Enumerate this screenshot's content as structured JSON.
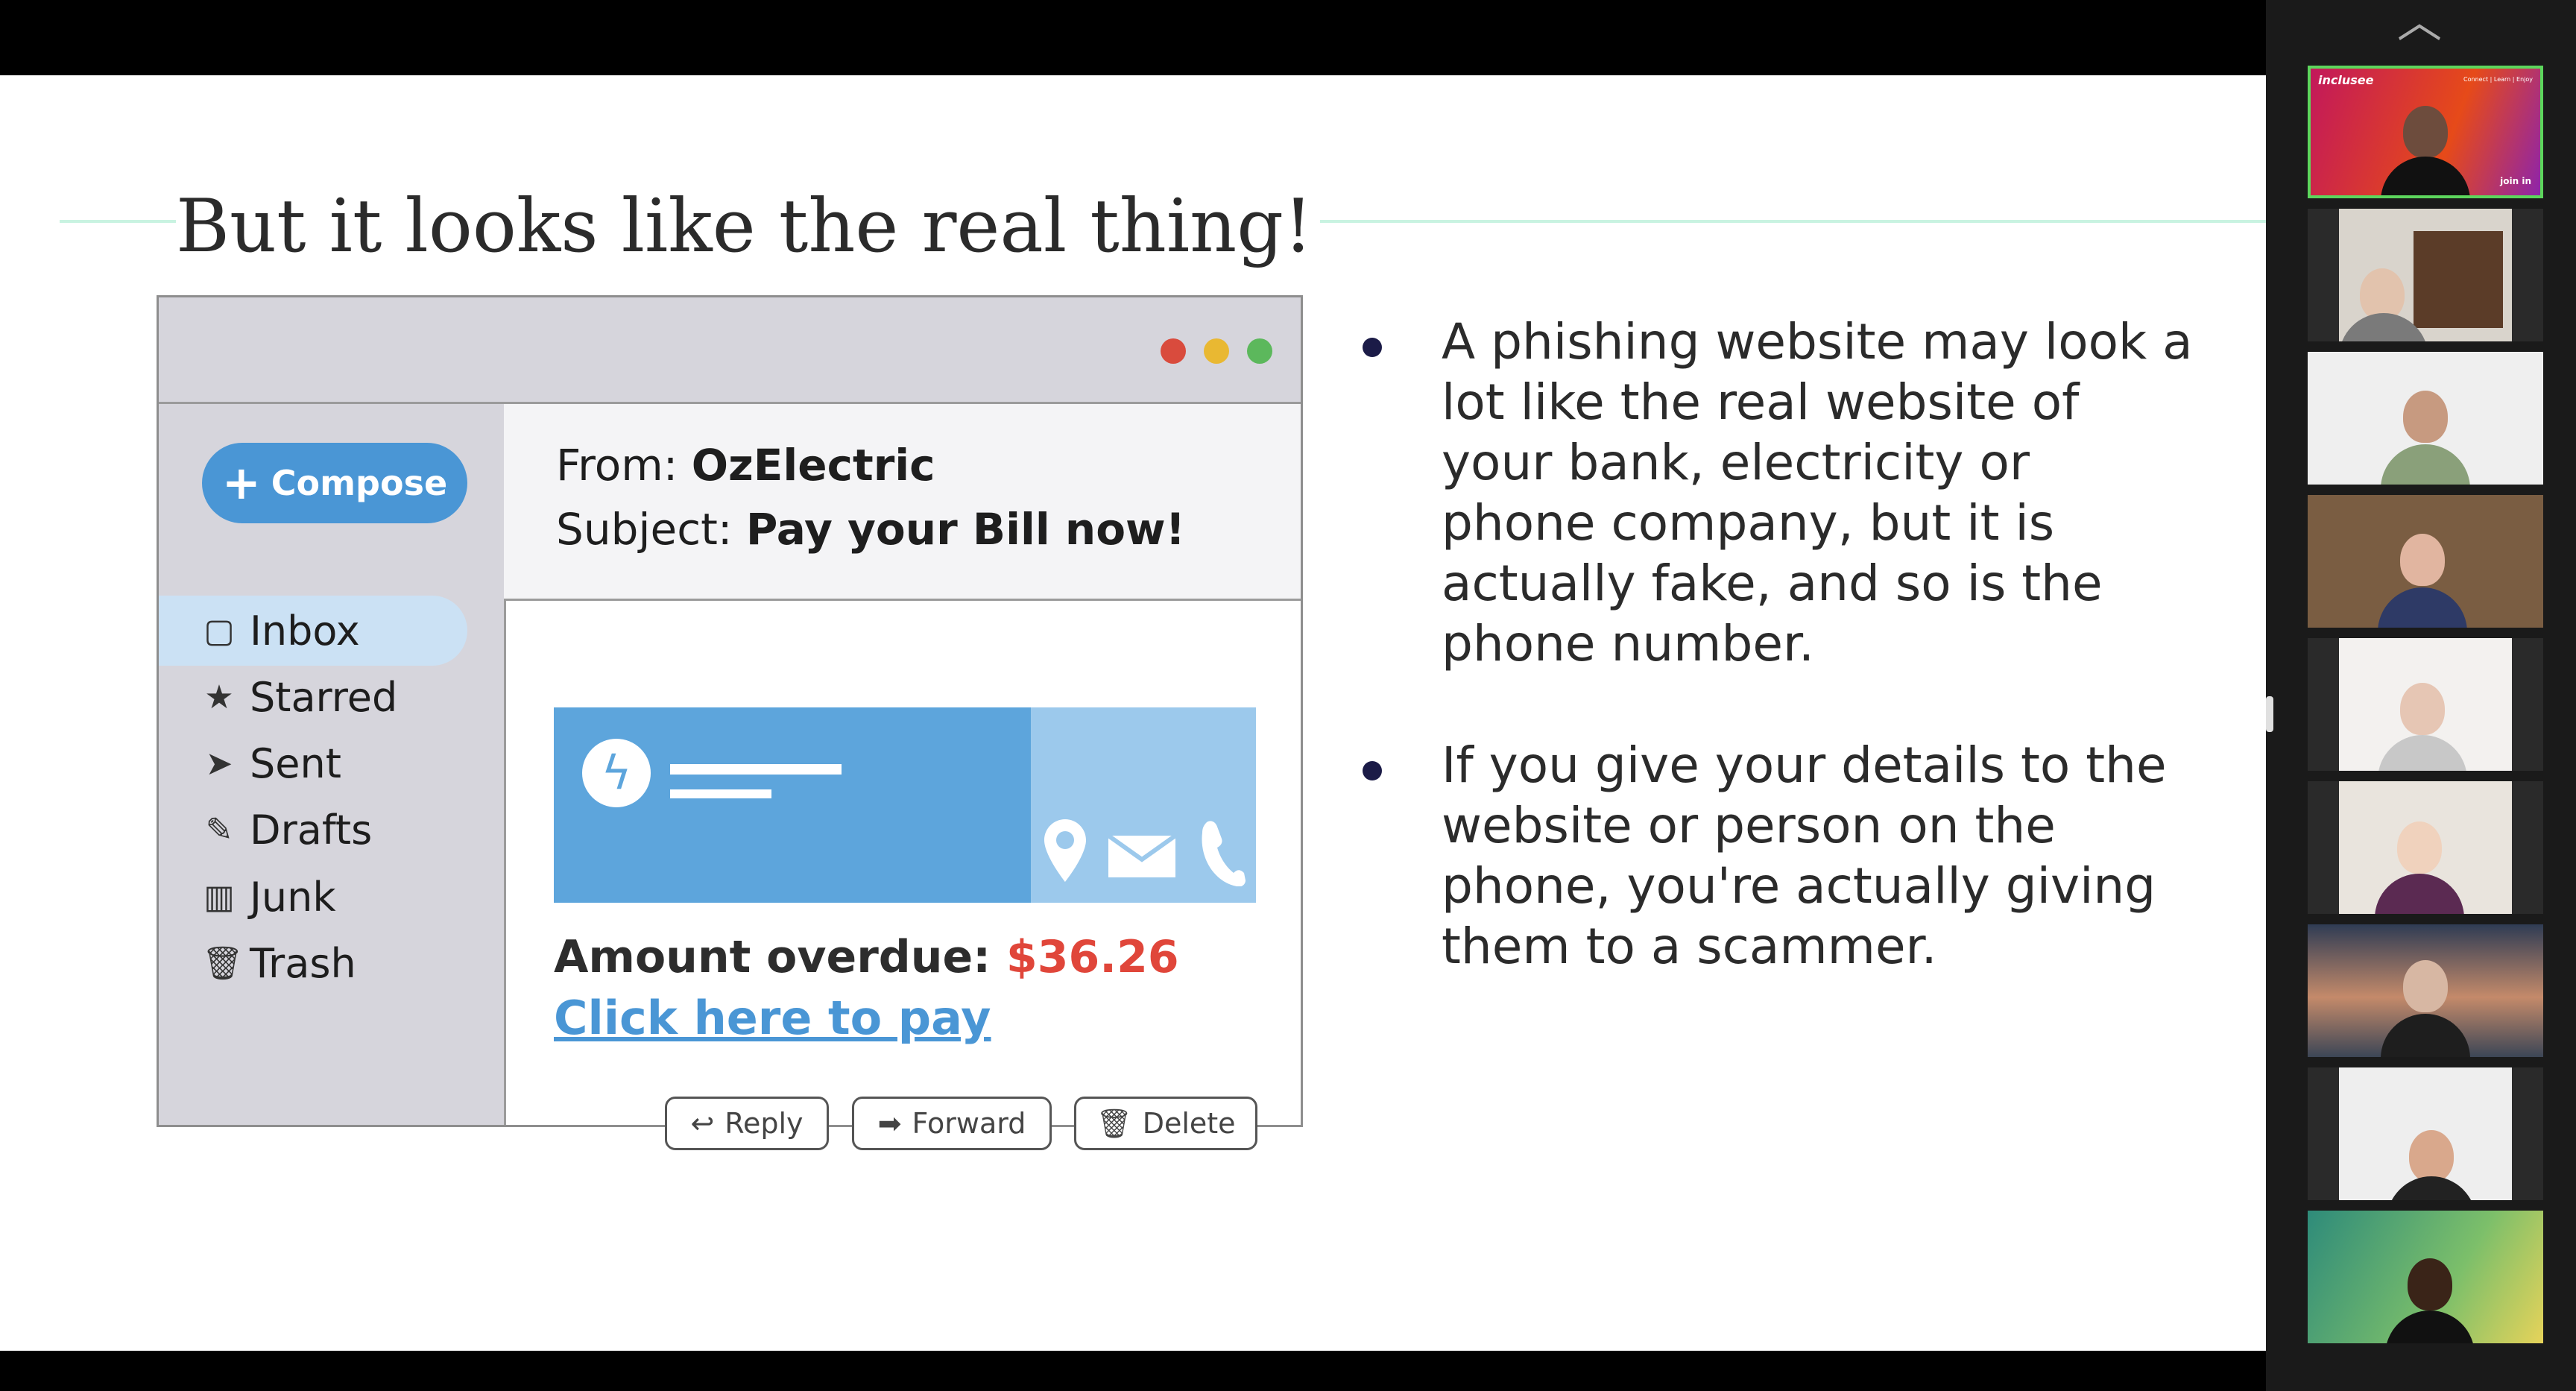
{
  "slide": {
    "title": "But it looks like the real thing!",
    "email_mockup": {
      "window_dots": [
        "#d94b3d",
        "#e9b832",
        "#5cb85c"
      ],
      "compose_label": "Compose",
      "folders": [
        {
          "label": "Inbox",
          "icon": "inbox-icon",
          "selected": true
        },
        {
          "label": "Starred",
          "icon": "star-icon"
        },
        {
          "label": "Sent",
          "icon": "send-icon"
        },
        {
          "label": "Drafts",
          "icon": "pencil-icon"
        },
        {
          "label": "Junk",
          "icon": "junk-icon"
        },
        {
          "label": "Trash",
          "icon": "trash-icon"
        }
      ],
      "from_label": "From: ",
      "from_value": "OzElectric",
      "subject_label": "Subject: ",
      "subject_value": "Pay your Bill now!",
      "banner_icons": [
        "lightning-icon",
        "location-pin-icon",
        "envelope-icon",
        "phone-icon"
      ],
      "amount_label": "Amount overdue: ",
      "amount_value": "$36.26",
      "link_text": "Click here to pay",
      "buttons": {
        "reply": "Reply",
        "forward": "Forward",
        "delete": "Delete"
      },
      "accent_color": "#4a96d5",
      "alert_color": "#e0463a"
    },
    "bullets": [
      "A phishing website may look a lot like the real website of your bank, electricity or phone company, but it is actually fake, and so is the phone number.",
      "If you give your details to the website or person on the phone, you're actually giving them to a scammer."
    ]
  },
  "participants_panel": {
    "collapse_icon": "chevron-up-icon",
    "presenter_tile": {
      "logo": "inclusee",
      "tagline": "Connect | Learn | Enjoy",
      "tag": "join in"
    },
    "tile_count": 9
  }
}
